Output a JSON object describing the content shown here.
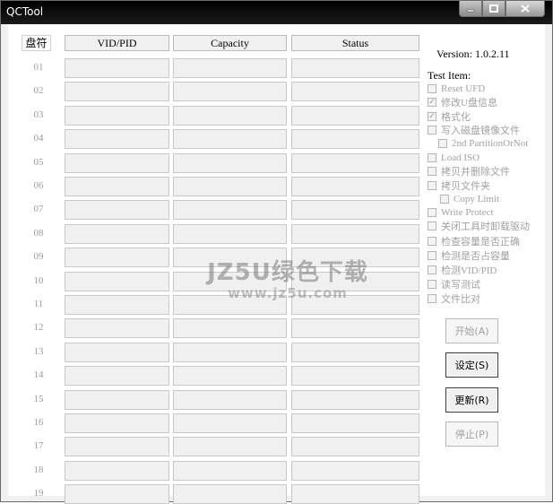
{
  "window": {
    "title": "QCTool"
  },
  "table": {
    "headers": {
      "index": "盘符",
      "vid_pid": "VID/PID",
      "capacity": "Capacity",
      "status": "Status"
    },
    "rows": [
      "01",
      "02",
      "03",
      "04",
      "05",
      "06",
      "07",
      "08",
      "09",
      "10",
      "11",
      "12",
      "13",
      "14",
      "15",
      "16",
      "17",
      "18",
      "19"
    ]
  },
  "version": "Version: 1.0.2.11",
  "test_items_label": "Test Item:",
  "test_items": [
    {
      "label": "Reset UFD",
      "checked": false
    },
    {
      "label": "修改U盘信息",
      "checked": true
    },
    {
      "label": "格式化",
      "checked": true
    },
    {
      "label": "写入磁盘镜像文件",
      "checked": false
    },
    {
      "label": "2nd PartitionOrNot",
      "checked": false
    },
    {
      "label": "Load ISO",
      "checked": false
    },
    {
      "label": "拷贝并删除文件",
      "checked": false
    },
    {
      "label": "拷贝文件夹",
      "checked": false
    },
    {
      "label": "Copy Limit",
      "checked": false
    },
    {
      "label": "Write Protect",
      "checked": false
    },
    {
      "label": "关闭工具时卸载驱动",
      "checked": false
    },
    {
      "label": "检查容量是否正确",
      "checked": false
    },
    {
      "label": "检测是否占容量",
      "checked": false
    },
    {
      "label": "检测VID/PID",
      "checked": false
    },
    {
      "label": "读写测试",
      "checked": false
    },
    {
      "label": "文件比对",
      "checked": false
    }
  ],
  "buttons": {
    "start": "开始(A)",
    "settings": "设定(S)",
    "update": "更新(R)",
    "stop": "停止(P)"
  },
  "watermark": {
    "line1": "JZ5U绿色下载",
    "line2": "www.jz5u.com"
  },
  "colors": {
    "titlebar": "#000000",
    "disabled_text": "#a0a0a0",
    "cell_bg": "#f0f0f0"
  }
}
